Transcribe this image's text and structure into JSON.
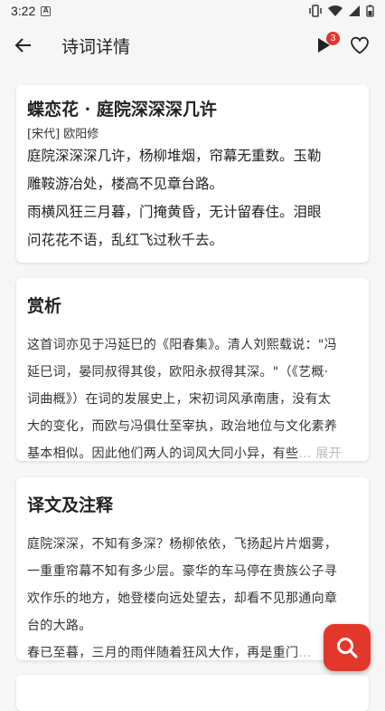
{
  "status": {
    "time": "3:22",
    "notif_icon": "A"
  },
  "appbar": {
    "title": "诗词详情",
    "badge_count": "3"
  },
  "poem": {
    "title": "蝶恋花 · 庭院深深深几许",
    "author": "[宋代] 欧阳修",
    "lines": [
      "庭院深深深几许，杨柳堆烟，帘幕无重数。玉勒",
      "雕鞍游冶处，楼高不见章台路。",
      "雨横风狂三月暮，门掩黄昏，无计留春住。泪眼",
      "问花花不语，乱红飞过秋千去。"
    ]
  },
  "appreciation": {
    "title": "赏析",
    "lines": [
      "这首词亦见于冯延巳的《阳春集》。清人刘熙载说：\"冯",
      "延巳词，晏同叔得其俊，欧阳永叔得其深。\"（《艺概·",
      "词曲概》）在词的发展史上，宋初词风承南唐，没有太",
      "大的变化，而欧与冯俱仕至宰执，政治地位与文化素养",
      "基本相似。因此他们两人的词风大同小异，有些"
    ],
    "more": "... 展开"
  },
  "translation": {
    "title": "译文及注释",
    "lines": [
      "庭院深深，不知有多深？杨柳依依，飞扬起片片烟雾，",
      "一重重帘幕不知有多少层。豪华的车马停在贵族公子寻",
      "欢作乐的地方，她登楼向远处望去，却看不见那通向章",
      "台的大路。",
      "春已至暮，三月的雨伴随着狂风大作，再是重门"
    ],
    "more": "..."
  }
}
